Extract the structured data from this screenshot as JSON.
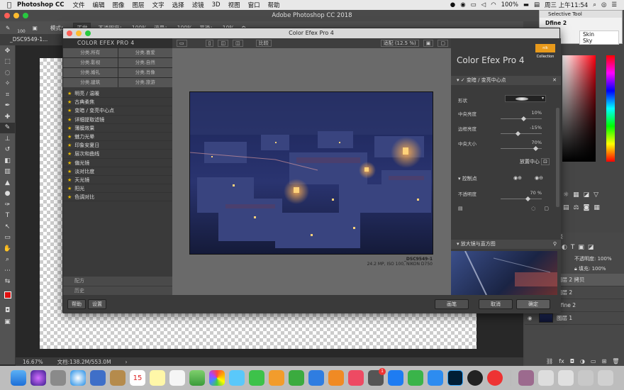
{
  "menubar": {
    "app_name": "Photoshop CC",
    "items": [
      "文件",
      "编辑",
      "图像",
      "图层",
      "文字",
      "选择",
      "滤镜",
      "3D",
      "视图",
      "窗口",
      "帮助"
    ],
    "battery": "100%",
    "clock": "周三 上午11:54"
  },
  "window": {
    "title": "Adobe Photoshop CC 2018"
  },
  "options_bar": {
    "brush_size": "100",
    "mode_label": "模式：",
    "mode_value": "正常",
    "opacity_label": "不透明度：",
    "opacity_value": "100%",
    "flow_label": "流量：",
    "flow_value": "100%",
    "smooth_label": "平滑：",
    "smooth_value": "10%"
  },
  "document_tab": "_DSC9549-1...",
  "status_bar": {
    "zoom": "16.67%",
    "doc_info": "文档:138.2M/553.0M"
  },
  "selective_tool": {
    "title": "Selective Tool",
    "selected": "Dfine 2",
    "items": [
      "Skin",
      "Sky"
    ],
    "side_label": "ound"
  },
  "color_efex": {
    "title": "Color Efex Pro 4",
    "brand": "COLOR EFEX PRO 4",
    "categories": [
      "分类.所有",
      "分类.喜爱",
      "分类.影视",
      "分类.自然",
      "分类.婚礼",
      "分类.肖像",
      "分类.建筑",
      "分类.旅游"
    ],
    "filters": [
      "明亮 / 温暖",
      "古典柔焦",
      "变暗 / 变亮中心点",
      "详细提取滤镜",
      "薄膜效果",
      "魅力光晕",
      "印象安夏日",
      "层次和曲线",
      "偏光镜",
      "淡对比度",
      "天光镜",
      "阳光",
      "色调对比"
    ],
    "sidebar_bottom": [
      "配方",
      "历史"
    ],
    "preview_toolbar": {
      "compare": "比较",
      "zoom": "适配 (12.5 %)"
    },
    "caption": {
      "name": "_DSC9549-1",
      "meta": "24.2 MP, ISO 100, NIKON D750"
    },
    "panel": {
      "logo": "Color Efex Pro 4",
      "nik_badge": "nik Collection",
      "filter_title": "变暗 / 变亮中心点",
      "shape_label": "形状",
      "sliders": [
        {
          "label": "中央亮度",
          "value": "10%",
          "pos": 0.55
        },
        {
          "label": "边框亮度",
          "value": "-15%",
          "pos": 0.42
        },
        {
          "label": "中央大小",
          "value": "70%",
          "pos": 0.85
        }
      ],
      "place_center": "放置中心",
      "control_points": "控制点",
      "opacity_label": "不透明度",
      "opacity_value": "70 %",
      "magnifier": "放大镜与直方图"
    },
    "buttons": {
      "help": "帮助",
      "settings": "设置",
      "brush": "画笔",
      "cancel": "取消",
      "ok": "确定"
    }
  },
  "layers": {
    "opacity_label": "不透明度:",
    "opacity_value": "100%",
    "fill_label": "填充:",
    "fill_value": "100%",
    "paths_label": "路径",
    "rows": [
      "图层 2 拷贝",
      "图层 2",
      "Dfine 2",
      "图层 1"
    ]
  },
  "dock": {
    "calendar_day": "15",
    "badge_count": "1"
  }
}
